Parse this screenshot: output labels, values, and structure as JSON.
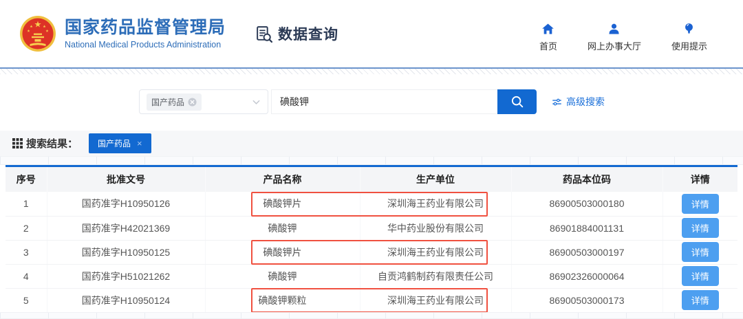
{
  "header": {
    "site_title": "国家药品监督管理局",
    "site_subtitle": "National Medical Products Administration",
    "section_title": "数据查询",
    "nav": [
      {
        "label": "首页",
        "icon": "home-icon"
      },
      {
        "label": "网上办事大厅",
        "icon": "user-icon"
      },
      {
        "label": "使用提示",
        "icon": "lightbulb-icon"
      }
    ]
  },
  "search": {
    "category_tag": "国产药品",
    "query": "碘酸钾",
    "advanced_label": "高级搜索"
  },
  "results": {
    "label": "搜索结果：",
    "filter_tag": "国产药品",
    "filter_close": "×"
  },
  "table": {
    "columns": [
      "序号",
      "批准文号",
      "产品名称",
      "生产单位",
      "药品本位码",
      "详情"
    ],
    "detail_label": "详情",
    "rows": [
      {
        "no": "1",
        "approval": "国药准字H10950126",
        "product": "碘酸钾片",
        "manufacturer": "深圳海王药业有限公司",
        "code": "86900503000180",
        "highlighted": true
      },
      {
        "no": "2",
        "approval": "国药准字H42021369",
        "product": "碘酸钾",
        "manufacturer": "华中药业股份有限公司",
        "code": "86901884001131",
        "highlighted": false
      },
      {
        "no": "3",
        "approval": "国药准字H10950125",
        "product": "碘酸钾片",
        "manufacturer": "深圳海王药业有限公司",
        "code": "86900503000197",
        "highlighted": true
      },
      {
        "no": "4",
        "approval": "国药准字H51021262",
        "product": "碘酸钾",
        "manufacturer": "自贡鸿鹤制药有限责任公司",
        "code": "86902326000064",
        "highlighted": false
      },
      {
        "no": "5",
        "approval": "国药准字H10950124",
        "product": "碘酸钾颗粒",
        "manufacturer": "深圳海王药业有限公司",
        "code": "86900503000173",
        "highlighted": true
      }
    ]
  },
  "colors": {
    "brand_blue": "#2d6db8",
    "accent_blue": "#1269d1",
    "button_light_blue": "#4d9ff0",
    "link_blue": "#1a6fd9",
    "highlight_red": "#f0503f"
  }
}
